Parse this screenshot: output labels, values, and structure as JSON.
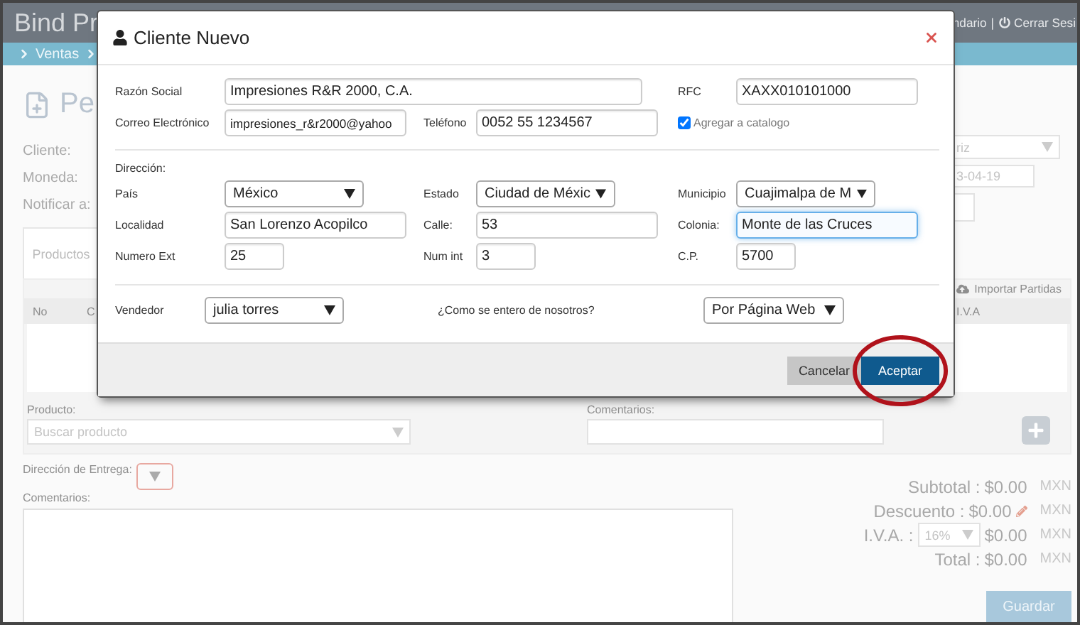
{
  "app": {
    "title": "Bind Pr",
    "header_links": [
      "ndario",
      "Cerrar Sesi"
    ],
    "header_separator": "|"
  },
  "breadcrumb": [
    "Ventas"
  ],
  "page": {
    "title": "Pe",
    "labels": [
      "Cliente:",
      "Moneda:",
      "Notificar a:"
    ],
    "client_select": "riz",
    "date": "3-04-19",
    "tab": {
      "label": "Productos",
      "selected": true
    },
    "import_link": "Importar Partidas",
    "table_columns": [
      "No",
      "C",
      "I.V.A"
    ],
    "product_label": "Producto:",
    "product_placeholder": "Buscar producto",
    "product_comment_label": "Comentarios:",
    "delivery_label": "Dirección de Entrega:",
    "comments_label": "Comentarios:",
    "totals": [
      {
        "kind": "plain",
        "label": "Subtotal :",
        "value": "$0.00",
        "currency": "MXN"
      },
      {
        "kind": "editable",
        "label": "Descuento :",
        "value": "$0.00",
        "currency": "MXN"
      },
      {
        "kind": "select",
        "label": "I.V.A. :",
        "option": "16%",
        "value": "$0.00",
        "currency": "MXN"
      },
      {
        "kind": "plain",
        "label": "Total :",
        "value": "$0.00",
        "currency": "MXN"
      }
    ],
    "save_button": "Guardar"
  },
  "modal": {
    "title": "Cliente Nuevo",
    "razon_social": {
      "label": "Razón Social",
      "value": "Impresiones R&R 2000, C.A."
    },
    "rfc": {
      "label": "RFC",
      "value": "XAXX010101000"
    },
    "correo": {
      "label": "Correo Electrónico",
      "value": "impresiones_r&r2000@yahoo"
    },
    "telefono": {
      "label": "Teléfono",
      "value": "0052 55 1234567"
    },
    "catalog": {
      "label": "Agregar a catalogo",
      "checked": true
    },
    "address_heading": "Dirección:",
    "address": [
      [
        {
          "kind": "select",
          "label": "País",
          "value": "México",
          "focused": false
        },
        {
          "kind": "select",
          "label": "Estado",
          "value": "Ciudad de Méxic",
          "focused": false
        },
        {
          "kind": "select",
          "label": "Municipio",
          "value": "Cuajimalpa de M",
          "focused": false
        }
      ],
      [
        {
          "kind": "text",
          "label": "Localidad",
          "value": "San Lorenzo Acopilco",
          "focused": false
        },
        {
          "kind": "text",
          "label": "Calle:",
          "value": "53",
          "focused": false
        },
        {
          "kind": "text",
          "label": "Colonia:",
          "value": "Monte de las Cruces",
          "focused": true
        }
      ],
      [
        {
          "kind": "number",
          "label": "Numero Ext",
          "value": "25",
          "focused": false
        },
        {
          "kind": "number",
          "label": "Num int",
          "value": "3",
          "focused": false
        },
        {
          "kind": "number",
          "label": "C.P.",
          "value": "5700",
          "focused": false
        }
      ]
    ],
    "vendedor": {
      "label": "Vendedor",
      "value": "julia torres"
    },
    "source": {
      "label": "¿Como se entero de nosotros?",
      "value": "Por Página Web"
    },
    "buttons": [
      {
        "kind": "secondary",
        "label": "Cancelar",
        "circled": false
      },
      {
        "kind": "primary",
        "label": "Aceptar",
        "circled": true
      }
    ]
  }
}
